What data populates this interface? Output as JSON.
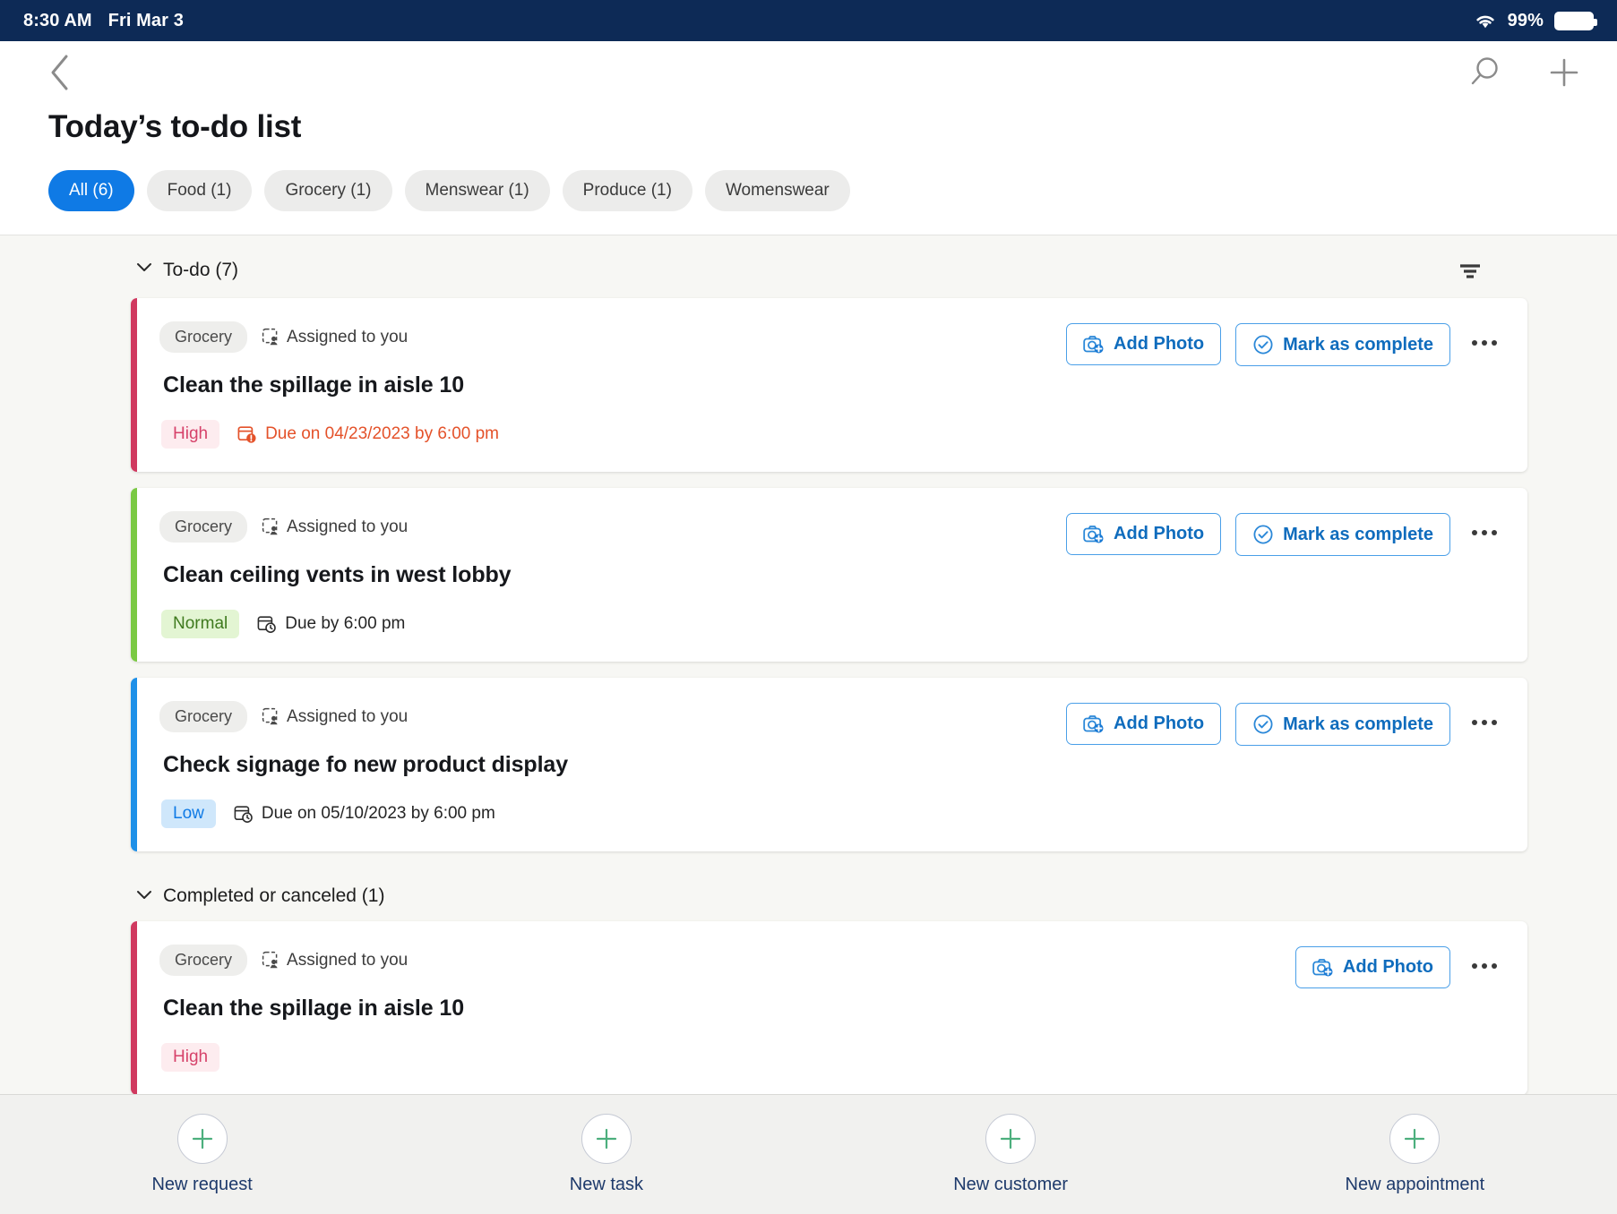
{
  "statusbar": {
    "time": "8:30 AM",
    "date": "Fri Mar 3",
    "battery_percent": "99%",
    "wifi_icon": "wifi-icon",
    "battery_icon": "battery-icon"
  },
  "header": {
    "back_icon": "back-chevron-icon",
    "title": "Today’s to-do list",
    "search_icon": "search-icon",
    "add_icon": "plus-icon",
    "chips": [
      {
        "label": "All (6)",
        "active": true
      },
      {
        "label": "Food (1)",
        "active": false
      },
      {
        "label": "Grocery (1)",
        "active": false
      },
      {
        "label": "Menswear (1)",
        "active": false
      },
      {
        "label": "Produce (1)",
        "active": false
      },
      {
        "label": "Womenswear",
        "active": false
      }
    ]
  },
  "groups": [
    {
      "title": "To-do (7)",
      "caret_icon": "chevron-down-icon",
      "filter_icon": "filter-icon",
      "has_filter": true
    },
    {
      "title": "Completed or canceled (1)",
      "caret_icon": "chevron-down-icon",
      "has_filter": false
    }
  ],
  "tasks": [
    {
      "accent_color": "#d0395f",
      "category": "Grocery",
      "assigned_icon": "assigned-to-you-icon",
      "assigned": "Assigned to you",
      "title": "Clean the spillage in aisle 10",
      "priority": "High",
      "priority_class": "high",
      "due_icon": "calendar-alert-icon",
      "due": "Due on 04/23/2023 by 6:00 pm",
      "overdue": true,
      "actions": [
        {
          "label": "Add Photo",
          "icon": "camera-add-icon"
        },
        {
          "label": "Mark as complete",
          "icon": "check-circle-icon"
        }
      ],
      "kebab_icon": "more-options-icon"
    },
    {
      "accent_color": "#7ac943",
      "category": "Grocery",
      "assigned_icon": "assigned-to-you-icon",
      "assigned": "Assigned to you",
      "title": "Clean ceiling vents in west lobby",
      "priority": "Normal",
      "priority_class": "normal",
      "due_icon": "calendar-clock-icon",
      "due": "Due by 6:00 pm",
      "overdue": false,
      "actions": [
        {
          "label": "Add Photo",
          "icon": "camera-add-icon"
        },
        {
          "label": "Mark as complete",
          "icon": "check-circle-icon"
        }
      ],
      "kebab_icon": "more-options-icon"
    },
    {
      "accent_color": "#1e90e8",
      "category": "Grocery",
      "assigned_icon": "assigned-to-you-icon",
      "assigned": "Assigned to you",
      "title": "Check signage fo new product display",
      "priority": "Low",
      "priority_class": "low",
      "due_icon": "calendar-clock-icon",
      "due": "Due on 05/10/2023 by 6:00 pm",
      "overdue": false,
      "actions": [
        {
          "label": "Add Photo",
          "icon": "camera-add-icon"
        },
        {
          "label": "Mark as complete",
          "icon": "check-circle-icon"
        }
      ],
      "kebab_icon": "more-options-icon"
    }
  ],
  "completed_tasks": [
    {
      "accent_color": "#d0395f",
      "category": "Grocery",
      "assigned_icon": "assigned-to-you-icon",
      "assigned": "Assigned to you",
      "title": "Clean the spillage in aisle 10",
      "priority": "High",
      "priority_class": "high",
      "due": "",
      "actions": [
        {
          "label": "Add Photo",
          "icon": "camera-add-icon"
        }
      ],
      "kebab_icon": "more-options-icon"
    }
  ],
  "bottombar": {
    "items": [
      {
        "label": "New request",
        "icon": "plus-circle-icon"
      },
      {
        "label": "New task",
        "icon": "plus-circle-icon"
      },
      {
        "label": "New customer",
        "icon": "plus-circle-icon"
      },
      {
        "label": "New appointment",
        "icon": "plus-circle-icon"
      }
    ]
  },
  "colors": {
    "statusbar_bg": "#0d2a56",
    "accent_blue": "#0f7ae5",
    "button_blue": "#0f6cbd",
    "overdue_red": "#e4522a",
    "high": "#d6426a",
    "normal": "#3f7a1e",
    "low": "#0f7ae5"
  }
}
